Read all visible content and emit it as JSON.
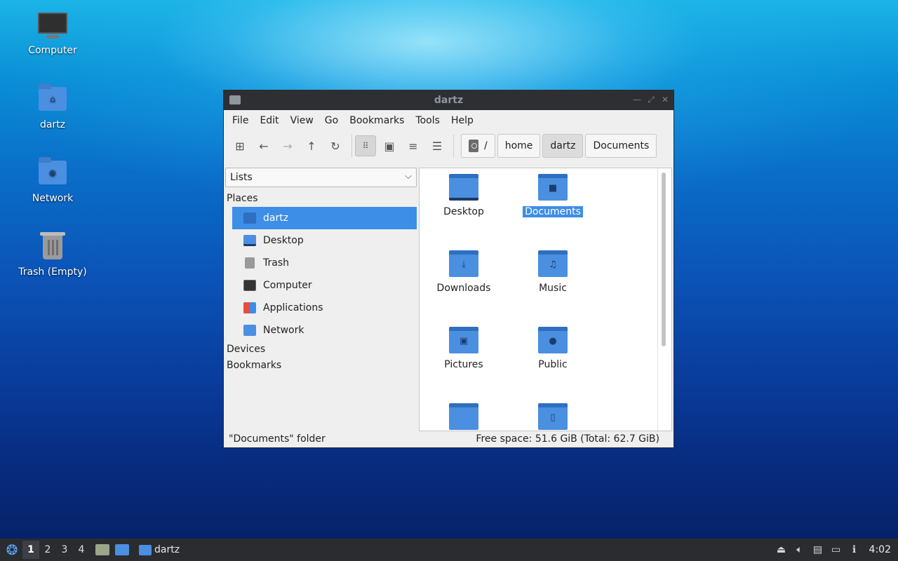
{
  "desktop": {
    "icons": [
      {
        "label": "Computer",
        "icon": "computer-icon"
      },
      {
        "label": "dartz",
        "icon": "home-folder-icon"
      },
      {
        "label": "Network",
        "icon": "network-folder-icon"
      },
      {
        "label": "Trash (Empty)",
        "icon": "trash-icon"
      }
    ]
  },
  "window": {
    "title": "dartz",
    "menu": [
      "File",
      "Edit",
      "View",
      "Go",
      "Bookmarks",
      "Tools",
      "Help"
    ],
    "toolbar": {
      "buttons": [
        "new-tab-icon",
        "back-arrow-icon",
        "forward-arrow-icon",
        "up-arrow-icon",
        "reload-icon",
        "icon-view-icon",
        "thumbnail-view-icon",
        "compact-view-icon",
        "detailed-list-view-icon"
      ]
    },
    "breadcrumbs": [
      "/",
      "home",
      "dartz",
      "Documents"
    ],
    "sidebar": {
      "mode": "Lists",
      "sections": {
        "places": "Places",
        "devices": "Devices",
        "bookmarks": "Bookmarks"
      },
      "places": [
        {
          "label": "dartz",
          "icon": "home-folder-icon",
          "selected": true
        },
        {
          "label": "Desktop",
          "icon": "desktop-icon"
        },
        {
          "label": "Trash",
          "icon": "trash-icon"
        },
        {
          "label": "Computer",
          "icon": "computer-icon"
        },
        {
          "label": "Applications",
          "icon": "applications-icon"
        },
        {
          "label": "Network",
          "icon": "network-folder-icon"
        }
      ]
    },
    "files": [
      {
        "label": "Desktop",
        "icon": "desktop-folder-icon"
      },
      {
        "label": "Documents",
        "icon": "documents-folder-icon",
        "selected": true
      },
      {
        "label": "Downloads",
        "icon": "downloads-folder-icon"
      },
      {
        "label": "Music",
        "icon": "music-folder-icon"
      },
      {
        "label": "Pictures",
        "icon": "pictures-folder-icon"
      },
      {
        "label": "Public",
        "icon": "public-folder-icon"
      },
      {
        "label": "",
        "icon": "folder-icon"
      },
      {
        "label": "",
        "icon": "templates-folder-icon"
      }
    ],
    "status": {
      "left": "\"Documents\" folder",
      "right": "Free space: 51.6 GiB (Total: 62.7 GiB)"
    }
  },
  "taskbar": {
    "workspaces": [
      "1",
      "2",
      "3",
      "4"
    ],
    "current_workspace": "1",
    "task_label": "dartz",
    "clock": "4:02"
  },
  "colors": {
    "selection": "#3d8ee6",
    "folder": "#4a8fe0",
    "titlebar": "#2d2f33",
    "taskbar": "#2a2c30"
  }
}
